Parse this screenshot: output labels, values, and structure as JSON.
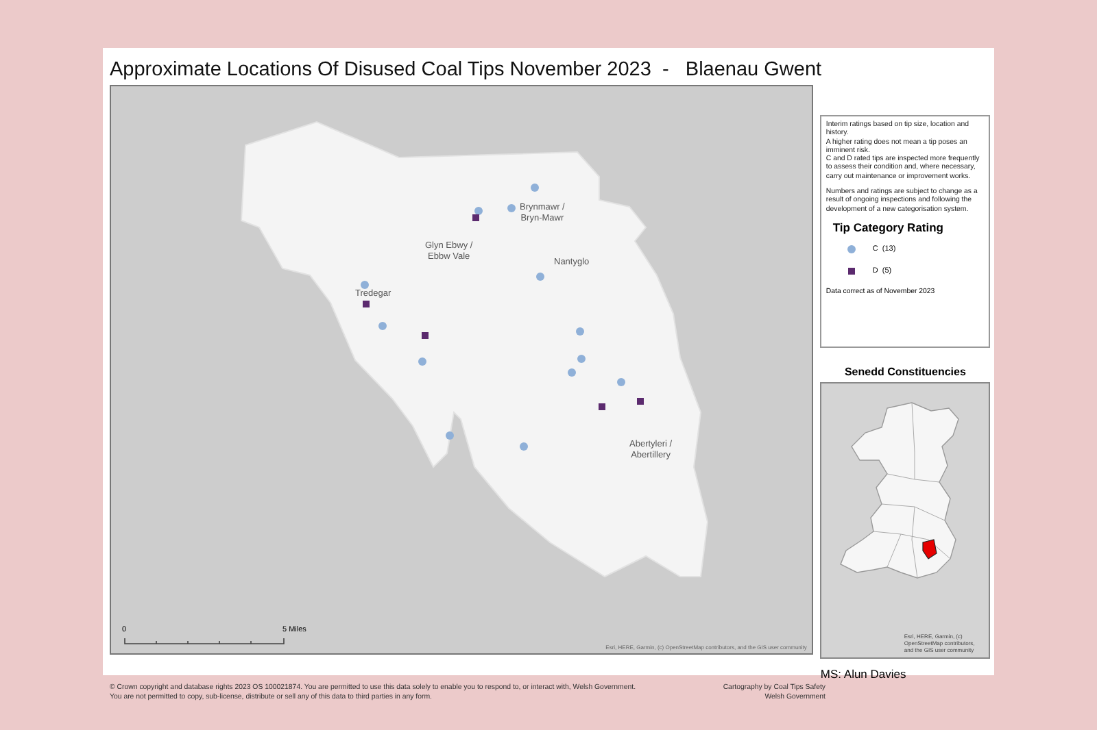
{
  "title": "Approximate Locations Of Disused Coal Tips November 2023  -   Blaenau Gwent",
  "map": {
    "towns": [
      {
        "lines": [
          "Brynmawr /",
          "Bryn-Mawr"
        ]
      },
      {
        "lines": [
          "Glyn Ebwy /",
          "Ebbw Vale"
        ]
      },
      {
        "lines": [
          "Nantyglo"
        ]
      },
      {
        "lines": [
          "Tredegar"
        ]
      },
      {
        "lines": [
          "Abertyleri /",
          "Abertillery"
        ]
      }
    ],
    "scale_bar": {
      "start": "0",
      "end": "5 Miles"
    },
    "attribution": "Esri, HERE, Garmin, (c) OpenStreetMap contributors, and the GIS user community"
  },
  "legend": {
    "notes": [
      [
        "Interim ratings based on tip size, location and history.",
        "A higher rating does not mean a tip poses an imminent risk.",
        "C and D rated tips are inspected more frequently to assess their condition and, where necessary, carry out maintenance or improvement works."
      ],
      [
        "Numbers and ratings are subject to change as a result of ongoing inspections and following the development of a new categorisation system."
      ]
    ],
    "heading": "Tip Category Rating",
    "items": [
      {
        "kind": "circle",
        "label": "C  (13)",
        "color": "#8fb0d8"
      },
      {
        "kind": "square",
        "label": "D  (5)",
        "color": "#5b2a6e"
      }
    ],
    "footnote": "Data correct as of November 2023"
  },
  "inset": {
    "title": "Senedd Constituencies",
    "attribution": "Esri, HERE, Garmin, (c) OpenStreetMap contributors, and the GIS user community",
    "member": "MS: Alun Davies"
  },
  "footer": {
    "copyright": [
      "© Crown copyright and database rights 2023 OS 100021874. You are permitted to use this data solely to enable you to respond to, or interact with, Welsh Government.",
      "You are not permitted to copy, sub-license, distribute or sell any of this data to third parties in any form."
    ],
    "credit": [
      "Cartography by Coal Tips Safety",
      "Welsh Government"
    ]
  }
}
